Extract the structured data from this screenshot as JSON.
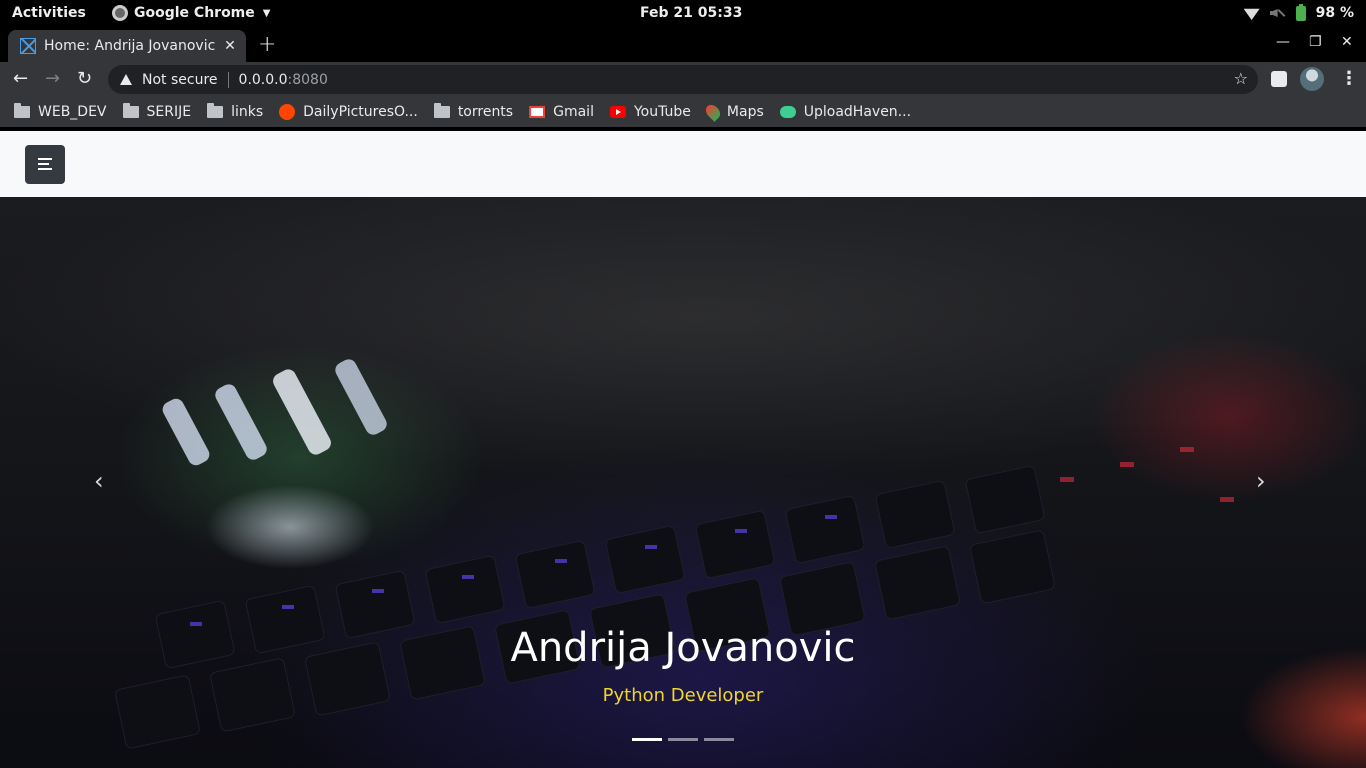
{
  "system_bar": {
    "activities": "Activities",
    "app_name": "Google Chrome",
    "clock": "Feb 21  05:33",
    "battery": "98 %"
  },
  "browser": {
    "tab_title": "Home: Andrija Jovanovic",
    "security_label": "Not secure",
    "url_host": "0.0.0.0",
    "url_port": ":8080",
    "bookmarks": [
      {
        "label": "WEB_DEV",
        "icon": "folder-icon"
      },
      {
        "label": "SERIJE",
        "icon": "folder-icon"
      },
      {
        "label": "links",
        "icon": "folder-icon"
      },
      {
        "label": "DailyPicturesO...",
        "icon": "reddit-icon"
      },
      {
        "label": "torrents",
        "icon": "folder-icon"
      },
      {
        "label": "Gmail",
        "icon": "gmail-icon"
      },
      {
        "label": "YouTube",
        "icon": "youtube-icon"
      },
      {
        "label": "Maps",
        "icon": "maps-icon"
      },
      {
        "label": "UploadHaven...",
        "icon": "cloud-icon"
      }
    ]
  },
  "hero": {
    "title": "Andrija Jovanovic",
    "subtitle": "Python Developer",
    "slide_count": 3,
    "active_slide": 1
  },
  "colors": {
    "subtitle": "#f0d531",
    "navbar_bg": "#f8f9fa",
    "toggler_bg": "#343a40"
  }
}
